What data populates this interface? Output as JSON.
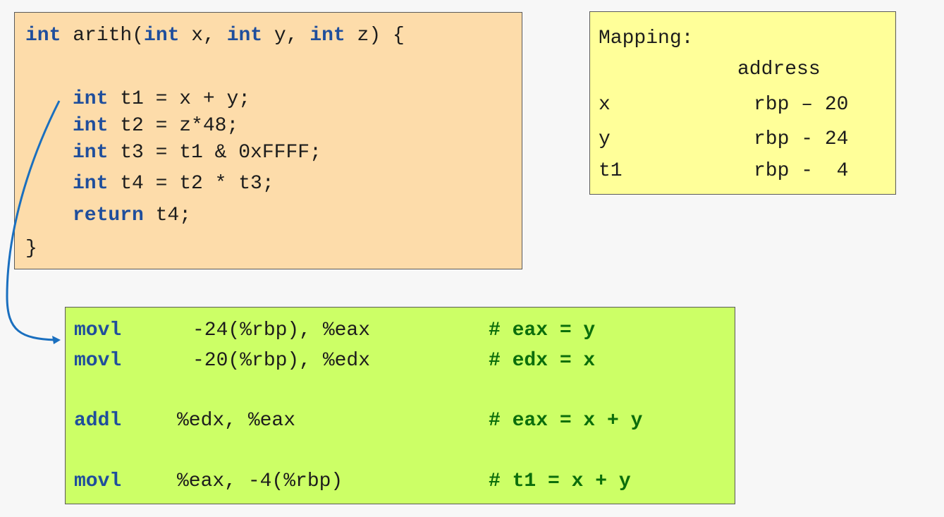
{
  "colors": {
    "keyword": "#1f4e9c",
    "comment": "#0b6e0b",
    "code_bg": "#fddcaa",
    "mapping_bg": "#ffff99",
    "asm_bg": "#ccff66",
    "arrow": "#1a6fbf"
  },
  "source_code": {
    "signature": {
      "kw1": "int",
      "t1": " arith(",
      "kw2": "int",
      "t2": " x, ",
      "kw3": "int",
      "t3": " y, ",
      "kw4": "int",
      "t4": " z) {"
    },
    "lines": [
      {
        "kw": "int",
        "text": " t1 = x + y;"
      },
      {
        "kw": "int",
        "text": " t2 = z*48;"
      },
      {
        "kw": "int",
        "text": " t3 = t1 & 0xFFFF;"
      },
      {
        "kw": "int",
        "text": " t4 = t2 * t3;"
      },
      {
        "kw": "return",
        "text": " t4;"
      }
    ],
    "closing": "}"
  },
  "mapping": {
    "title": "Mapping:",
    "header": "address",
    "rows": [
      {
        "var": "x",
        "addr": "rbp – 20"
      },
      {
        "var": "y",
        "addr": "rbp - 24"
      },
      {
        "var": "t1",
        "addr": "rbp -  4"
      }
    ]
  },
  "assembly": [
    {
      "op": "movl",
      "args": "-24(%rbp), %eax",
      "comment": "# eax = y"
    },
    {
      "op": "movl",
      "args": "-20(%rbp), %edx",
      "comment": "# edx = x"
    },
    {
      "op": "addl",
      "args": "%edx, %eax",
      "comment": "# eax = x + y"
    },
    {
      "op": "movl",
      "args": "%eax, -4(%rbp)",
      "comment": "# t1 = x + y"
    }
  ]
}
